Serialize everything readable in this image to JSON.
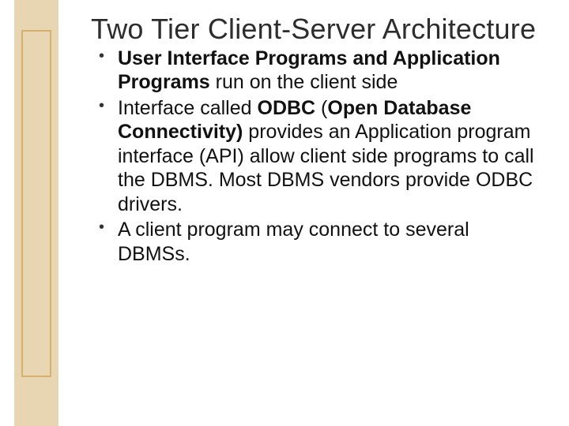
{
  "slide": {
    "title": "Two Tier Client-Server Architecture",
    "bullets": [
      {
        "seg1_bold": "User Interface Programs and Application Programs",
        "seg2": " run on the client side"
      },
      {
        "seg1": "Interface called ",
        "seg2_bold": "ODBC",
        "seg3": " (",
        "seg4_bold": "Open Database Connectivity)",
        "seg5": " provides an Application program interface (API) allow client side programs to call the DBMS. Most DBMS vendors provide ODBC drivers."
      },
      {
        "seg1": "A client program may connect to several DBMSs."
      }
    ]
  }
}
